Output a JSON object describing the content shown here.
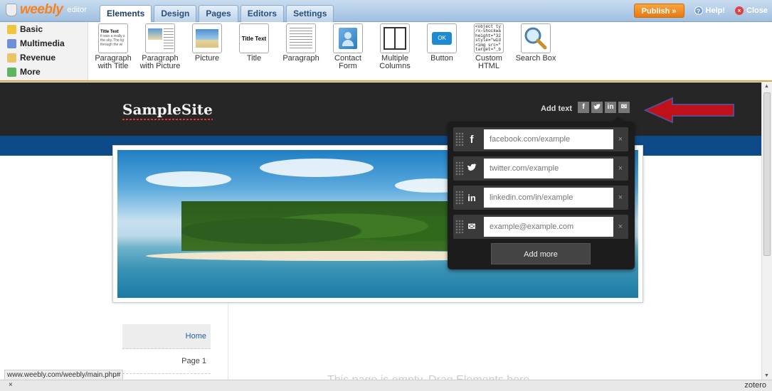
{
  "logo": {
    "brand": "weebly",
    "sub": "editor"
  },
  "tabs": [
    {
      "label": "Elements"
    },
    {
      "label": "Design"
    },
    {
      "label": "Pages"
    },
    {
      "label": "Editors"
    },
    {
      "label": "Settings"
    }
  ],
  "topright": {
    "publish": "Publish »",
    "help": "Help!",
    "close": "Close"
  },
  "categories": [
    {
      "label": "Basic"
    },
    {
      "label": "Multimedia"
    },
    {
      "label": "Revenue"
    },
    {
      "label": "More"
    }
  ],
  "elements": [
    {
      "label": "Paragraph\nwith Title",
      "thumb_title": "Title Text",
      "thumb_text": "It was a really s the sky. The lig through the wi"
    },
    {
      "label": "Paragraph\nwith Picture"
    },
    {
      "label": "Picture"
    },
    {
      "label": "Title",
      "thumb_title": "Title Text"
    },
    {
      "label": "Paragraph"
    },
    {
      "label": "Contact\nForm"
    },
    {
      "label": "Multiple\nColumns"
    },
    {
      "label": "Button",
      "thumb_text": "OK"
    },
    {
      "label": "Custom\nHTML",
      "thumb_text": "<object ty /x-shockwa height=\"32 style=\"wid <img src=\" target=\"_b"
    },
    {
      "label": "Search Box"
    }
  ],
  "site": {
    "title": "SampleSite",
    "add_text": "Add text",
    "social_icons": [
      "f",
      "t",
      "in",
      "✉"
    ]
  },
  "popup": {
    "rows": [
      {
        "icon": "facebook-icon",
        "glyph": "f",
        "placeholder": "facebook.com/example"
      },
      {
        "icon": "twitter-icon",
        "glyph": "t",
        "placeholder": "twitter.com/example"
      },
      {
        "icon": "linkedin-icon",
        "glyph": "in",
        "placeholder": "linkedin.com/in/example"
      },
      {
        "icon": "email-icon",
        "glyph": "✉",
        "placeholder": "example@example.com"
      }
    ],
    "close": "×",
    "add_more": "Add more"
  },
  "nav": [
    {
      "label": "Home"
    },
    {
      "label": "Page 1"
    }
  ],
  "body_text": "This page is empty. Drag Elements here.",
  "status": {
    "url": "www.weebly.com/weebly/main.php#",
    "close": "×",
    "addon": "zotero"
  },
  "colors": {
    "accent": "#f58220",
    "header": "#262626",
    "bluebar": "#0d4b88",
    "arrow": "#c0101a"
  }
}
